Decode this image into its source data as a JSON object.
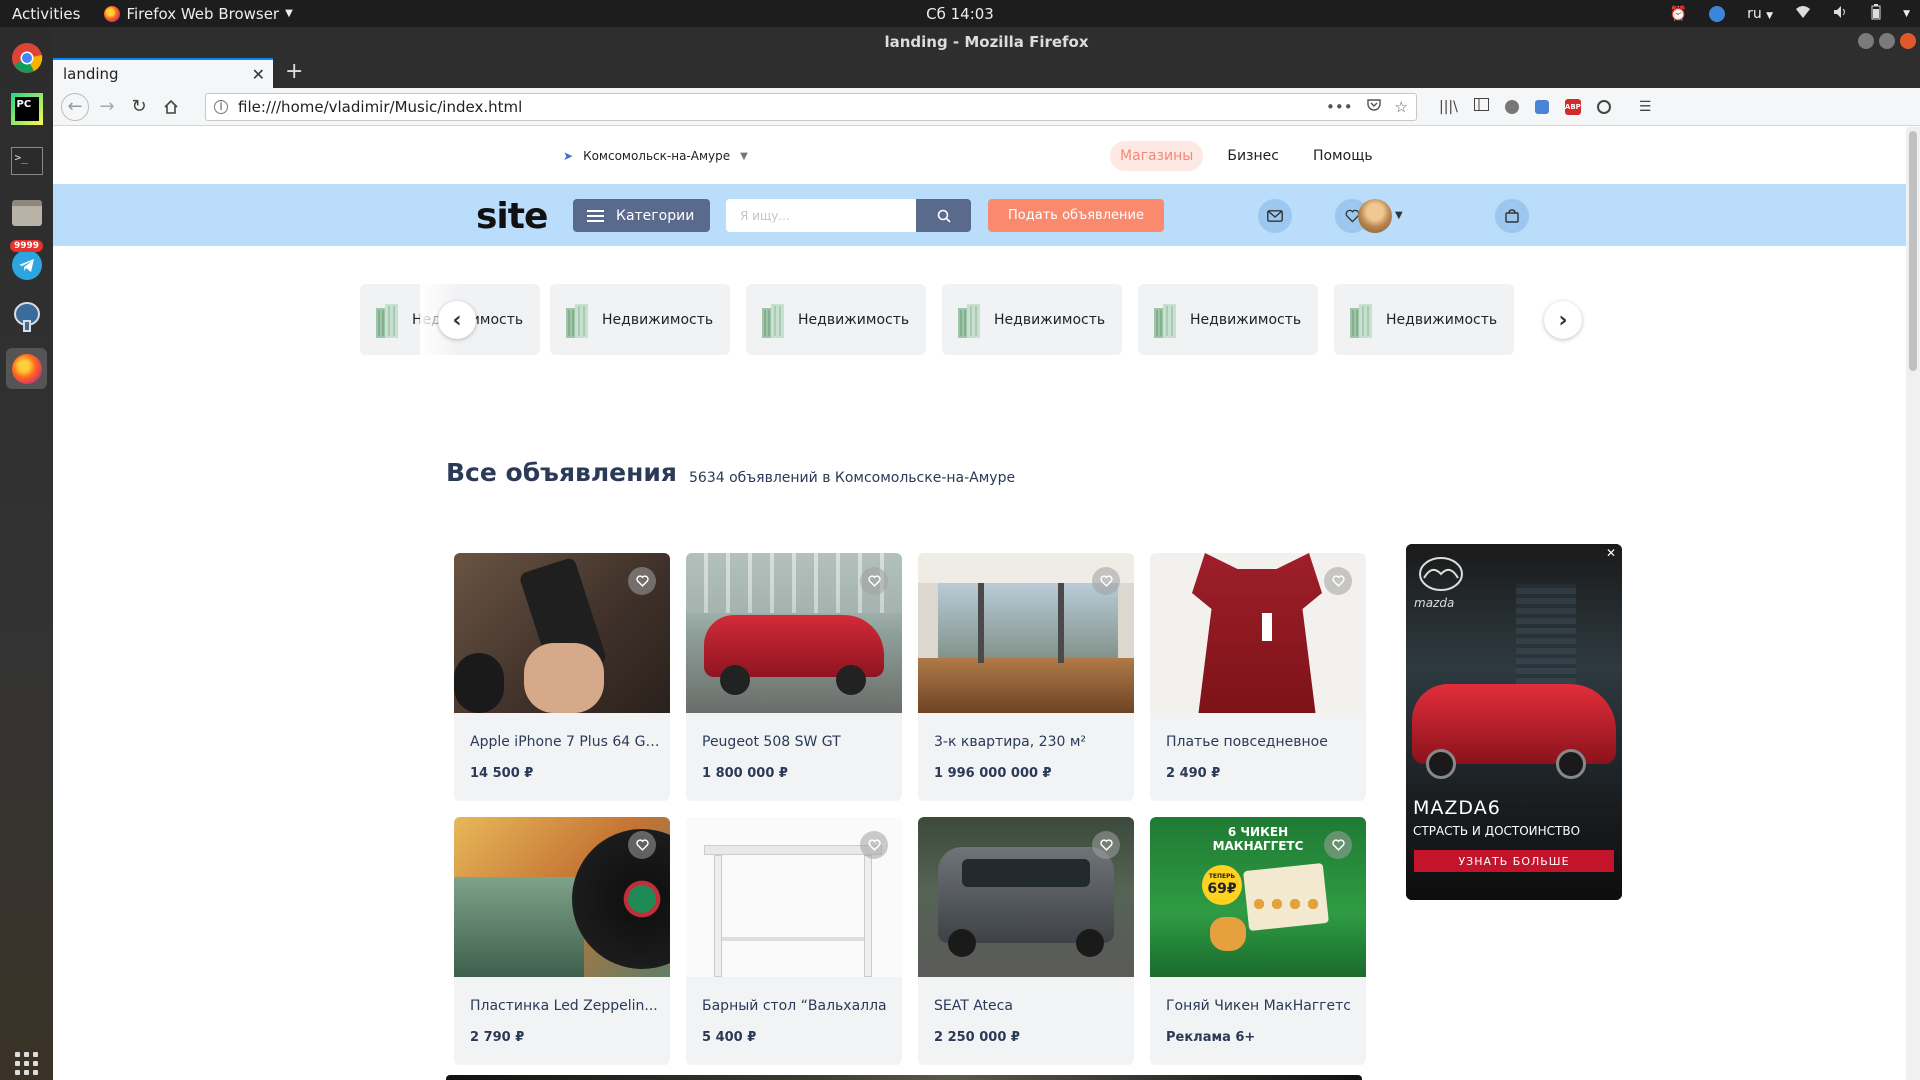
{
  "system_bar": {
    "activities": "Activities",
    "app_name": "Firefox Web Browser",
    "clock": "Сб 14:03",
    "language": "ru"
  },
  "dock": {
    "telegram_badge": "9999",
    "items": [
      "chrome-icon",
      "pycharm-icon",
      "terminal-icon",
      "files-icon",
      "telegram-icon",
      "pgadmin-icon",
      "firefox-icon",
      "app-grid-icon"
    ]
  },
  "browser": {
    "window_title": "landing - Mozilla Firefox",
    "tab_title": "landing",
    "url": "file:///home/vladimir/Music/index.html"
  },
  "site": {
    "city": "Комсомольск-на-Амуре",
    "nav": [
      {
        "label": "Магазины",
        "active": true
      },
      {
        "label": "Бизнес",
        "active": false
      },
      {
        "label": "Помощь",
        "active": false
      }
    ],
    "logo": "site",
    "categories_button": "Категории",
    "search_placeholder": "Я ищу...",
    "post_button": "Подать объявление",
    "colors": {
      "header_bg": "#b9ddfb",
      "primary": "#5a6a8d",
      "accent": "#f98a6d",
      "heading": "#2b3a57"
    },
    "category_items": [
      {
        "label": "Недвижимость"
      },
      {
        "label": "Недвижимость"
      },
      {
        "label": "Недвижимость"
      },
      {
        "label": "Недвижимость"
      },
      {
        "label": "Недвижимость"
      },
      {
        "label": "Недвижимость"
      }
    ],
    "section_title": "Все объявления",
    "section_count": "5634 объявлений в Комсомольске-на-Амуре",
    "listings": [
      {
        "title": "Apple iPhone 7 Plus 64 GB...",
        "price": "14 500 ₽"
      },
      {
        "title": "Peugeot 508 SW GT",
        "price": "1 800 000 ₽"
      },
      {
        "title": "3-к квартира, 230 м²",
        "price": "1 996 000 000 ₽"
      },
      {
        "title": "Платье повседневное",
        "price": "2 490 ₽"
      },
      {
        "title": "Пластинка Led Zeppelin...",
        "price": "2 790 ₽"
      },
      {
        "title": "Барный стол “Вальхалла",
        "price": "5 400 ₽"
      },
      {
        "title": "SEAT Ateca",
        "price": "2 250 000 ₽"
      },
      {
        "title": "Гоняй Чикен МакНаггетс",
        "price": "Реклама 6+"
      }
    ],
    "ad": {
      "brand": "mazda",
      "model": "MAZDA6",
      "slogan": "СТРАСТЬ И ДОСТОИНСТВО",
      "cta": "УЗНАТЬ БОЛЬШЕ",
      "close": "✕"
    },
    "promo_text": {
      "line1": "6 ЧИКЕН",
      "line2": "МАКНАГГЕТС",
      "badge_top": "ТЕПЕРЬ",
      "badge_price": "69₽"
    }
  }
}
